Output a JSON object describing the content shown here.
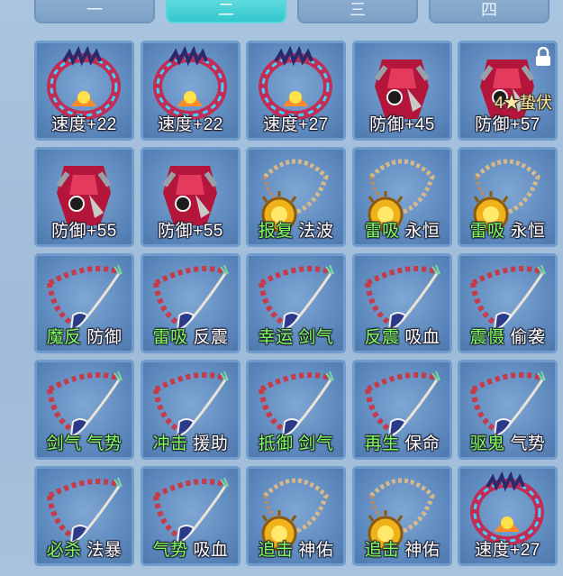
{
  "tabs": [
    {
      "label": "一",
      "active": false
    },
    {
      "label": "二",
      "active": true
    },
    {
      "label": "三",
      "active": false
    },
    {
      "label": "四",
      "active": false
    }
  ],
  "items": [
    {
      "icon": "bracelet-icon",
      "plain": "速度+22"
    },
    {
      "icon": "bracelet-icon",
      "plain": "速度+22"
    },
    {
      "icon": "bracelet-icon",
      "plain": "速度+27"
    },
    {
      "icon": "armor-icon",
      "plain": "防御+45"
    },
    {
      "icon": "armor-icon",
      "plain": "防御+57",
      "sub": "4★蛰伏",
      "locked": true
    },
    {
      "icon": "armor-icon",
      "plain": "防御+55"
    },
    {
      "icon": "armor-icon",
      "plain": "防御+55"
    },
    {
      "icon": "amulet-icon",
      "green": "报复",
      "plain": "法波"
    },
    {
      "icon": "amulet-icon",
      "green": "雷吸",
      "plain": "永恒"
    },
    {
      "icon": "amulet-icon",
      "green": "雷吸",
      "plain": "永恒"
    },
    {
      "icon": "necklace-icon",
      "green": "魔反",
      "plain": "防御"
    },
    {
      "icon": "necklace-icon",
      "green": "雷吸",
      "plain": "反震"
    },
    {
      "icon": "necklace-icon",
      "green": "幸运 剑气",
      "plain": ""
    },
    {
      "icon": "necklace-icon",
      "green": "反震",
      "plain": "吸血"
    },
    {
      "icon": "necklace-icon",
      "green": "震慑",
      "plain": "偷袭"
    },
    {
      "icon": "necklace-icon",
      "green": "剑气 气势",
      "plain": ""
    },
    {
      "icon": "necklace-icon",
      "green": "冲击",
      "plain": "援助"
    },
    {
      "icon": "necklace-icon",
      "green": "抵御 剑气",
      "plain": ""
    },
    {
      "icon": "necklace-icon",
      "green": "再生",
      "plain": "保命"
    },
    {
      "icon": "necklace-icon",
      "green": "驱鬼",
      "plain": "气势"
    },
    {
      "icon": "necklace-icon",
      "green": "必杀",
      "plain": "法暴"
    },
    {
      "icon": "necklace-icon",
      "green": "气势",
      "plain": "吸血"
    },
    {
      "icon": "amulet-icon",
      "green": "追击",
      "plain": "神佑"
    },
    {
      "icon": "amulet-icon",
      "green": "追击",
      "plain": "神佑"
    },
    {
      "icon": "bracelet-icon",
      "plain": "速度+27"
    }
  ],
  "colors": {
    "bonus_green": "#7dff5a",
    "active_tab": "#33c7cd"
  }
}
